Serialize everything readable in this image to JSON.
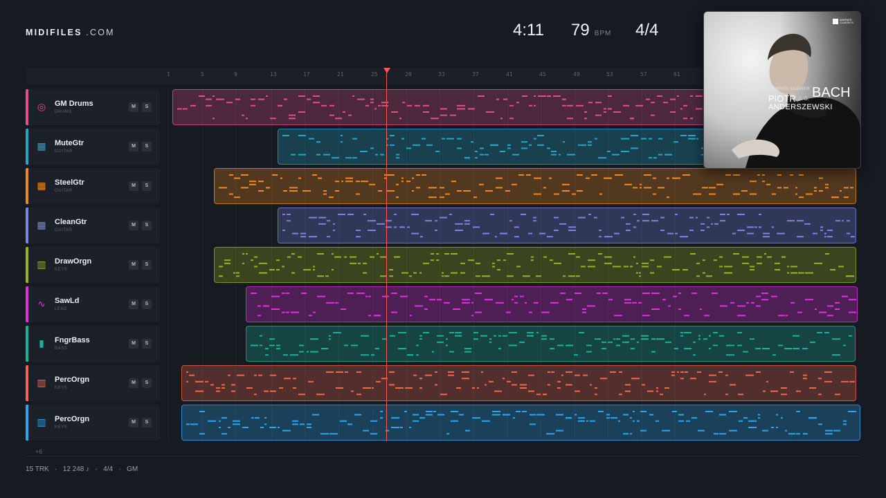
{
  "brand": {
    "name": "MIDIFILES",
    "suffix": ".COM"
  },
  "stats": {
    "duration": "4:11",
    "bpm": "79",
    "bpm_unit": "BPM",
    "time_signature": "4/4"
  },
  "ruler": {
    "ticks": [
      "1",
      "5",
      "9",
      "13",
      "17",
      "21",
      "25",
      "29",
      "33",
      "37",
      "41",
      "45",
      "49",
      "53",
      "57",
      "61"
    ]
  },
  "tracks": [
    {
      "name": "GM Drums",
      "category": "DRUMS",
      "color": "#e0508a",
      "icon": "drum-icon"
    },
    {
      "name": "MuteGtr",
      "category": "GUITAR",
      "color": "#22a6c9",
      "icon": "guitar-icon"
    },
    {
      "name": "SteelGtr",
      "category": "GUITAR",
      "color": "#f08a1e",
      "icon": "guitar-icon"
    },
    {
      "name": "CleanGtr",
      "category": "GUITAR",
      "color": "#7b84e6",
      "icon": "guitar-icon"
    },
    {
      "name": "DrawOrgn",
      "category": "KEYS",
      "color": "#9ab21e",
      "icon": "keys-icon"
    },
    {
      "name": "SawLd",
      "category": "LEAD",
      "color": "#e02ee0",
      "icon": "synth-wave-icon"
    },
    {
      "name": "FngrBass",
      "category": "BASS",
      "color": "#18b39a",
      "icon": "bass-icon"
    },
    {
      "name": "PercOrgn",
      "category": "KEYS",
      "color": "#f2664a",
      "icon": "keys-icon"
    },
    {
      "name": "PercOrgn",
      "category": "KEYS",
      "color": "#2aa6f0",
      "icon": "keys-icon"
    }
  ],
  "buttons": {
    "mute": "M",
    "solo": "S"
  },
  "more_tracks": "+6",
  "footer": {
    "tracks": "15 TRK",
    "notes": "12 248 ♪",
    "time_signature": "4/4",
    "standard": "GM",
    "separator": "·"
  },
  "album": {
    "subtitle": "WELL-TEMPERED CLAVIER",
    "artist_first": "PIOTR",
    "composer_initials": "J. S.",
    "composer": "BACH",
    "artist_last": "ANDERSZEWSKI",
    "label": "WARNER CLASSICS"
  }
}
